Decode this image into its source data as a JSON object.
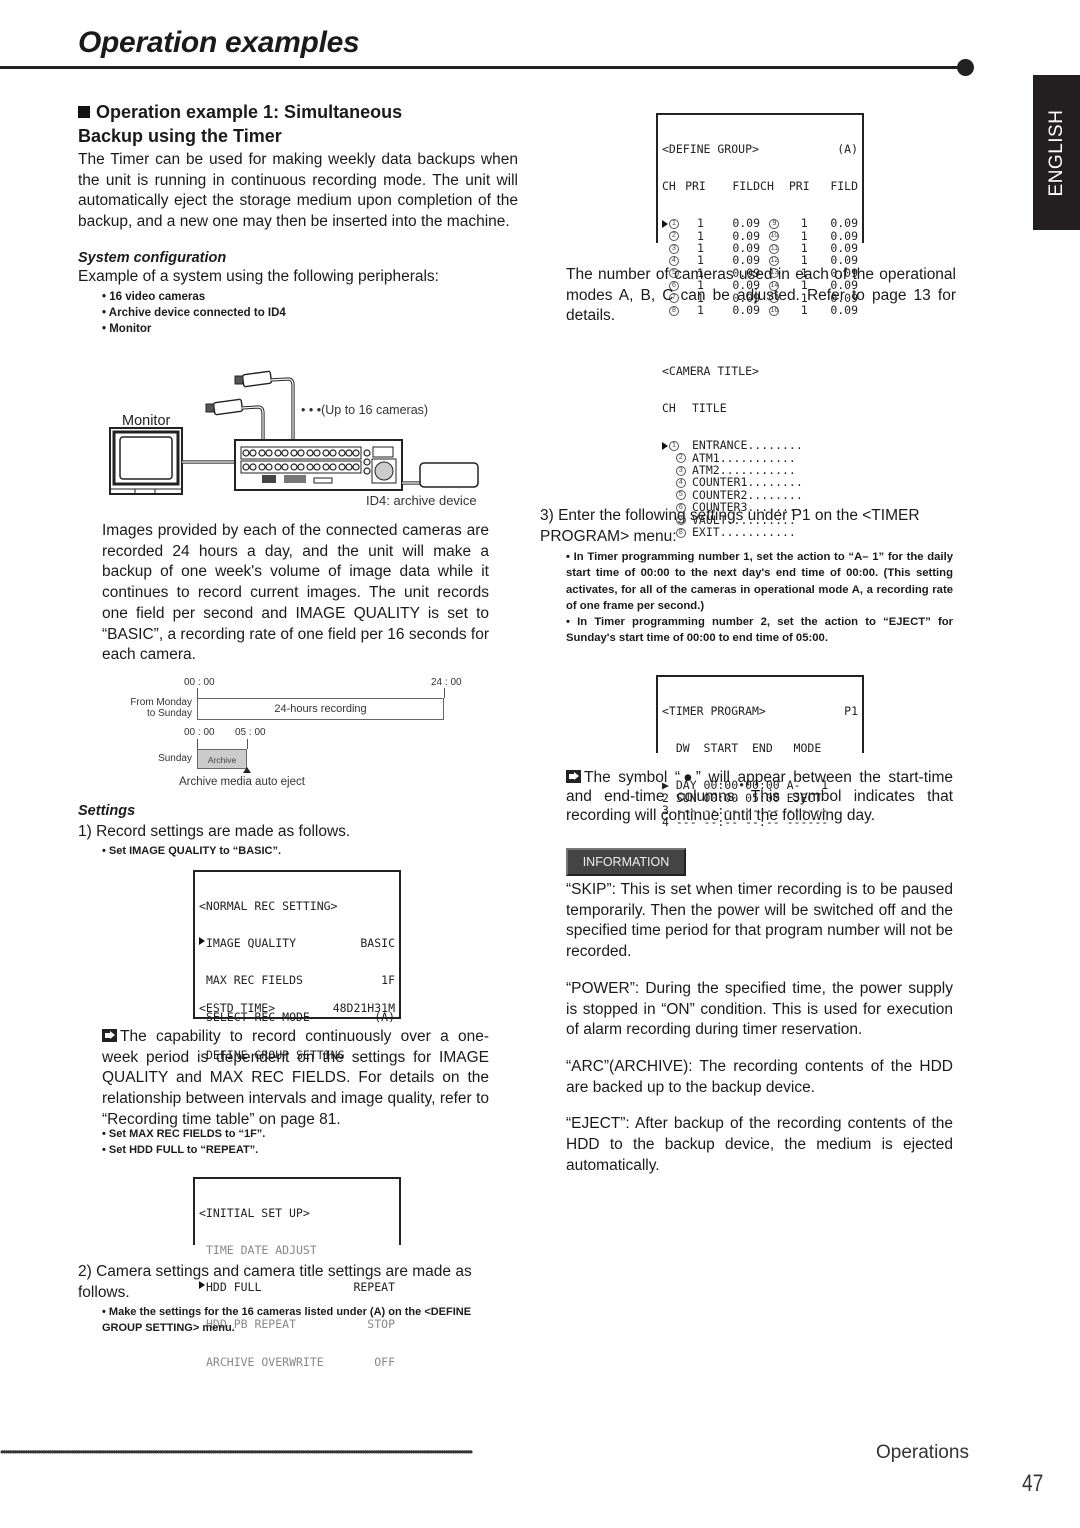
{
  "header": {
    "title": "Operation examples",
    "language_tab": "ENGLISH"
  },
  "section": {
    "heading_line1": "Operation example 1: Simultaneous",
    "heading_line2": "Backup using the Timer",
    "intro": "The Timer can be used for making weekly data backups when the unit is running in continuous recording mode. The unit will automatically eject the storage medium upon completion of the backup, and a new one may then be inserted into the machine."
  },
  "system_config": {
    "heading": "System configuration",
    "intro": "Example of a system using the following peripherals:",
    "bullets": [
      "• 16 video cameras",
      "• Archive device connected to ID4",
      "• Monitor"
    ],
    "diagram": {
      "monitor_label": "Monitor",
      "cameras_label": "• • •(Up to 16 cameras)",
      "archive_label": "ID4: archive device"
    },
    "description": "Images provided by each of the connected cameras are recorded 24 hours a day, and the unit will make a backup of one week's volume of image data while it continues to record current images. The unit records one field per second and IMAGE QUALITY is set to “BASIC”, a recording rate of one field per 16 seconds for each camera."
  },
  "timeline": {
    "row1_start": "00 : 00",
    "row1_end": "24 : 00",
    "row1_label_line1": "From Monday",
    "row1_label_line2": "to Sunday",
    "row1_bar": "24-hours recording",
    "row2_start": "00 : 00",
    "row2_end": "05 : 00",
    "row2_label": "Sunday",
    "row2_bar": "Archive",
    "caption": "Archive media auto eject"
  },
  "settings": {
    "heading": "Settings",
    "step1": "1) Record settings are made as follows.",
    "step1_bullet": "• Set IMAGE QUALITY to “BASIC”.",
    "normal_rec": {
      "title": "<NORMAL REC SETTING>",
      "items": [
        {
          "label": "IMAGE QUALITY",
          "value": "BASIC",
          "selected": true
        },
        {
          "label": "MAX REC FIELDS",
          "value": "1F",
          "selected": false
        },
        {
          "label": "SELECT REC MODE",
          "value": "(A)",
          "selected": false
        },
        {
          "label": "DEFINE GROUP SETTING",
          "value": "",
          "selected": false
        }
      ],
      "footer_label": "<ESTD TIME>",
      "footer_value": "48D21H31M"
    },
    "note1": "The capability to record continuously over a one-week period is dependent on the settings for IMAGE QUALITY and MAX REC FIELDS. For details on the relationship between intervals and image quality, refer to “Recording time table” on page 81.",
    "bullet_max_rec": "• Set MAX REC FIELDS to “1F”.",
    "bullet_hdd_full": "• Set HDD FULL to “REPEAT”.",
    "initial_setup": {
      "title": "<INITIAL SET UP>",
      "items": [
        {
          "label": "TIME DATE ADJUST",
          "value": "",
          "selected": false,
          "dim": true
        },
        {
          "label": "HDD FULL",
          "value": "REPEAT",
          "selected": true,
          "dim": false
        },
        {
          "label": "HDD PB REPEAT",
          "value": "STOP",
          "selected": false,
          "dim": true
        },
        {
          "label": "ARCHIVE OVERWRITE",
          "value": "OFF",
          "selected": false,
          "dim": true
        }
      ]
    },
    "step2": "2) Camera settings and camera title settings are made as follows.",
    "step2_bullet": "• Make the settings for the 16 cameras listed under (A) on the <DEFINE GROUP SETTING> menu."
  },
  "define_group": {
    "title": "<DEFINE GROUP>",
    "mode": "(A)",
    "header": [
      "CH",
      "PRI",
      "FILD",
      "CH",
      "PRI",
      "FILD"
    ],
    "rows": [
      [
        "1",
        "1",
        "0.09",
        "9",
        "1",
        "0.09"
      ],
      [
        "2",
        "1",
        "0.09",
        "10",
        "1",
        "0.09"
      ],
      [
        "3",
        "1",
        "0.09",
        "11",
        "1",
        "0.09"
      ],
      [
        "4",
        "1",
        "0.09",
        "12",
        "1",
        "0.09"
      ],
      [
        "5",
        "1",
        "0.09",
        "13",
        "1",
        "0.09"
      ],
      [
        "6",
        "1",
        "0.09",
        "14",
        "1",
        "0.09"
      ],
      [
        "7",
        "1",
        "0.09",
        "15",
        "1",
        "0.09"
      ],
      [
        "8",
        "1",
        "0.09",
        "16",
        "1",
        "0.09"
      ]
    ]
  },
  "right_text": {
    "cameras_note": "The number of cameras used in each of the operational modes A, B, C can be adjusted. Refer to page 13 for details.",
    "step3": "3) Enter the following settings under P1 on the <TIMER PROGRAM> menu:",
    "step3_bullet1": "• In Timer programming number 1, set the action to “A–   1” for the daily start time of 00:00 to the next day's end time of 00:00. (This setting activates, for all of the cameras in operational mode A, a recording rate of one frame per second.)",
    "step3_bullet2": "• In Timer programming number 2, set the action to “EJECT” for Sunday's start time of 00:00 to end time of 05:00.",
    "symbol_note": "The symbol “●” will appear between the start-time and end-time columns. This symbol indicates that recording will continue until the following day.",
    "info_button": "INFORMATION",
    "skip": "“SKIP”: This is set when timer recording is to be paused temporarily. Then the power will be switched off and the specified time period for that program number will not be recorded.",
    "power": "“POWER”: During the specified time, the power supply is stopped in “ON” condition. This is used for execution of alarm recording during timer reservation.",
    "arc": "“ARC”(ARCHIVE): The recording contents of the HDD are backed up to the backup device.",
    "eject": "“EJECT”: After backup of the recording contents of the HDD to the backup device, the medium is ejected automatically."
  },
  "camera_title": {
    "title": "<CAMERA TITLE>",
    "header_ch": "CH",
    "header_title": "TITLE",
    "rows": [
      {
        "ch": "1",
        "title": "ENTRANCE........"
      },
      {
        "ch": "2",
        "title": "ATM1..........."
      },
      {
        "ch": "3",
        "title": "ATM2..........."
      },
      {
        "ch": "4",
        "title": "COUNTER1........"
      },
      {
        "ch": "5",
        "title": "COUNTER2........"
      },
      {
        "ch": "6",
        "title": "COUNTER3........"
      },
      {
        "ch": "7",
        "title": "VAULT.........."
      },
      {
        "ch": "8",
        "title": "EXIT..........."
      }
    ]
  },
  "timer_program": {
    "title": "<TIMER PROGRAM>",
    "page": "P1",
    "header": "  DW  START  END   MODE",
    "rows": [
      {
        "no": "▶",
        "line": " DAY 00:00•00:00 A-   1"
      },
      {
        "no": "2",
        "line": " SUN 00:00 05:00 EJECT"
      },
      {
        "no": "3",
        "line": " --- --:-- --:-- ------"
      },
      {
        "no": "4",
        "line": " --- --:-- --:-- ------"
      }
    ]
  },
  "footer": {
    "section": "Operations",
    "page_number": "47"
  }
}
